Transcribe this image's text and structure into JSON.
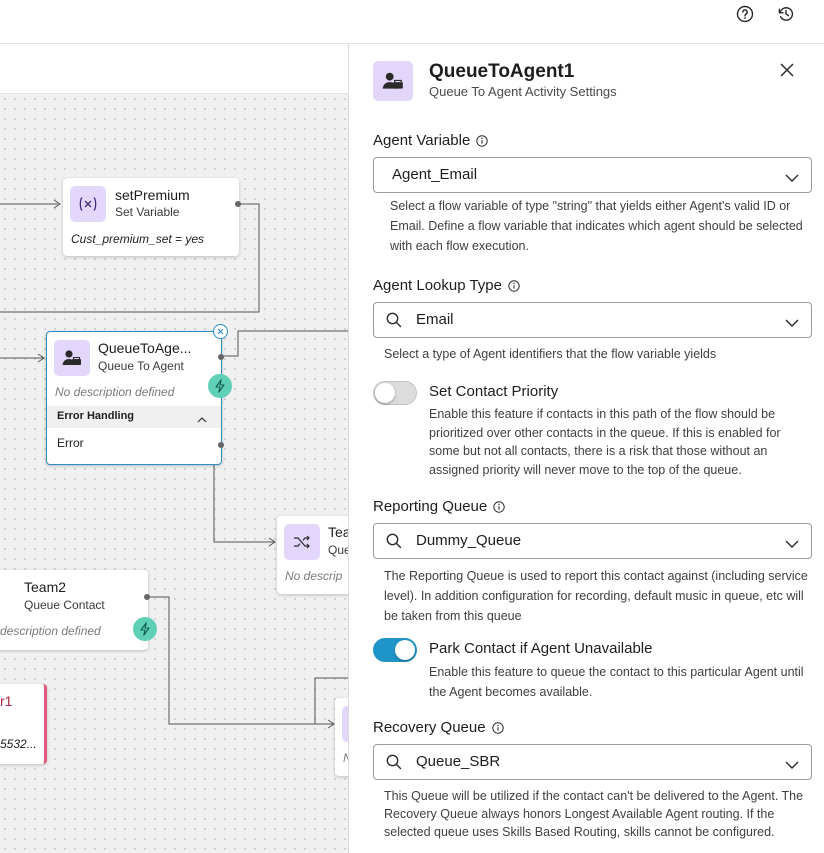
{
  "header": {
    "help_icon": "help-circle-icon",
    "history_icon": "history-icon"
  },
  "canvas": {
    "nodes": {
      "set_premium": {
        "title": "setPremium",
        "subtitle": "Set Variable",
        "value": "Cust_premium_set = yes"
      },
      "queue_to_agent": {
        "title": "QueueToAge...",
        "subtitle": "Queue To Agent",
        "description": "No description defined",
        "error_handling_label": "Error Handling",
        "error_label": "Error"
      },
      "team_partial": {
        "title": "Tea",
        "subtitle": "Que",
        "description": "No descrip"
      },
      "team2": {
        "title": "Team2",
        "subtitle": "Queue Contact",
        "description": "description defined"
      },
      "partial_node": {
        "title": "r1",
        "value": "5532..."
      },
      "partial_node2": {
        "description": "N"
      }
    }
  },
  "panel": {
    "title": "QueueToAgent1",
    "subtitle": "Queue To Agent Activity Settings",
    "agent_variable": {
      "label": "Agent Variable",
      "value": "Agent_Email",
      "help": "Select a flow variable of type \"string\" that yields either Agent's valid ID or Email. Define a flow variable that indicates which agent should be selected with each flow execution."
    },
    "agent_lookup_type": {
      "label": "Agent Lookup Type",
      "value": "Email",
      "help": "Select a type of Agent identifiers that the flow variable yields"
    },
    "set_contact_priority": {
      "label": "Set Contact Priority",
      "enabled": false,
      "help": "Enable this feature if contacts in this path of the flow should be prioritized over other contacts in the queue. If this is enabled for some but not all contacts, there is a risk that those without an assigned priority will never move to the top of the queue."
    },
    "reporting_queue": {
      "label": "Reporting Queue",
      "value": "Dummy_Queue",
      "help": "The Reporting Queue is used to report this contact against (including service level). In addition configuration for recording, default music in queue, etc will be taken from this queue"
    },
    "park_contact": {
      "label": "Park Contact if Agent Unavailable",
      "enabled": true,
      "help": "Enable this feature to queue the contact to this particular Agent until the Agent becomes available."
    },
    "recovery_queue": {
      "label": "Recovery Queue",
      "value": "Queue_SBR",
      "help": "This Queue will be utilized if the contact can't be delivered to the Agent. The Recovery Queue always honors Longest Available Agent routing. If the selected queue uses Skills Based Routing, skills cannot be configured."
    }
  },
  "colors": {
    "accent": "#1f94c8",
    "icon_bg": "#e3d6fb",
    "bolt": "#5fd0b6",
    "error_node": "#e05a7a"
  }
}
